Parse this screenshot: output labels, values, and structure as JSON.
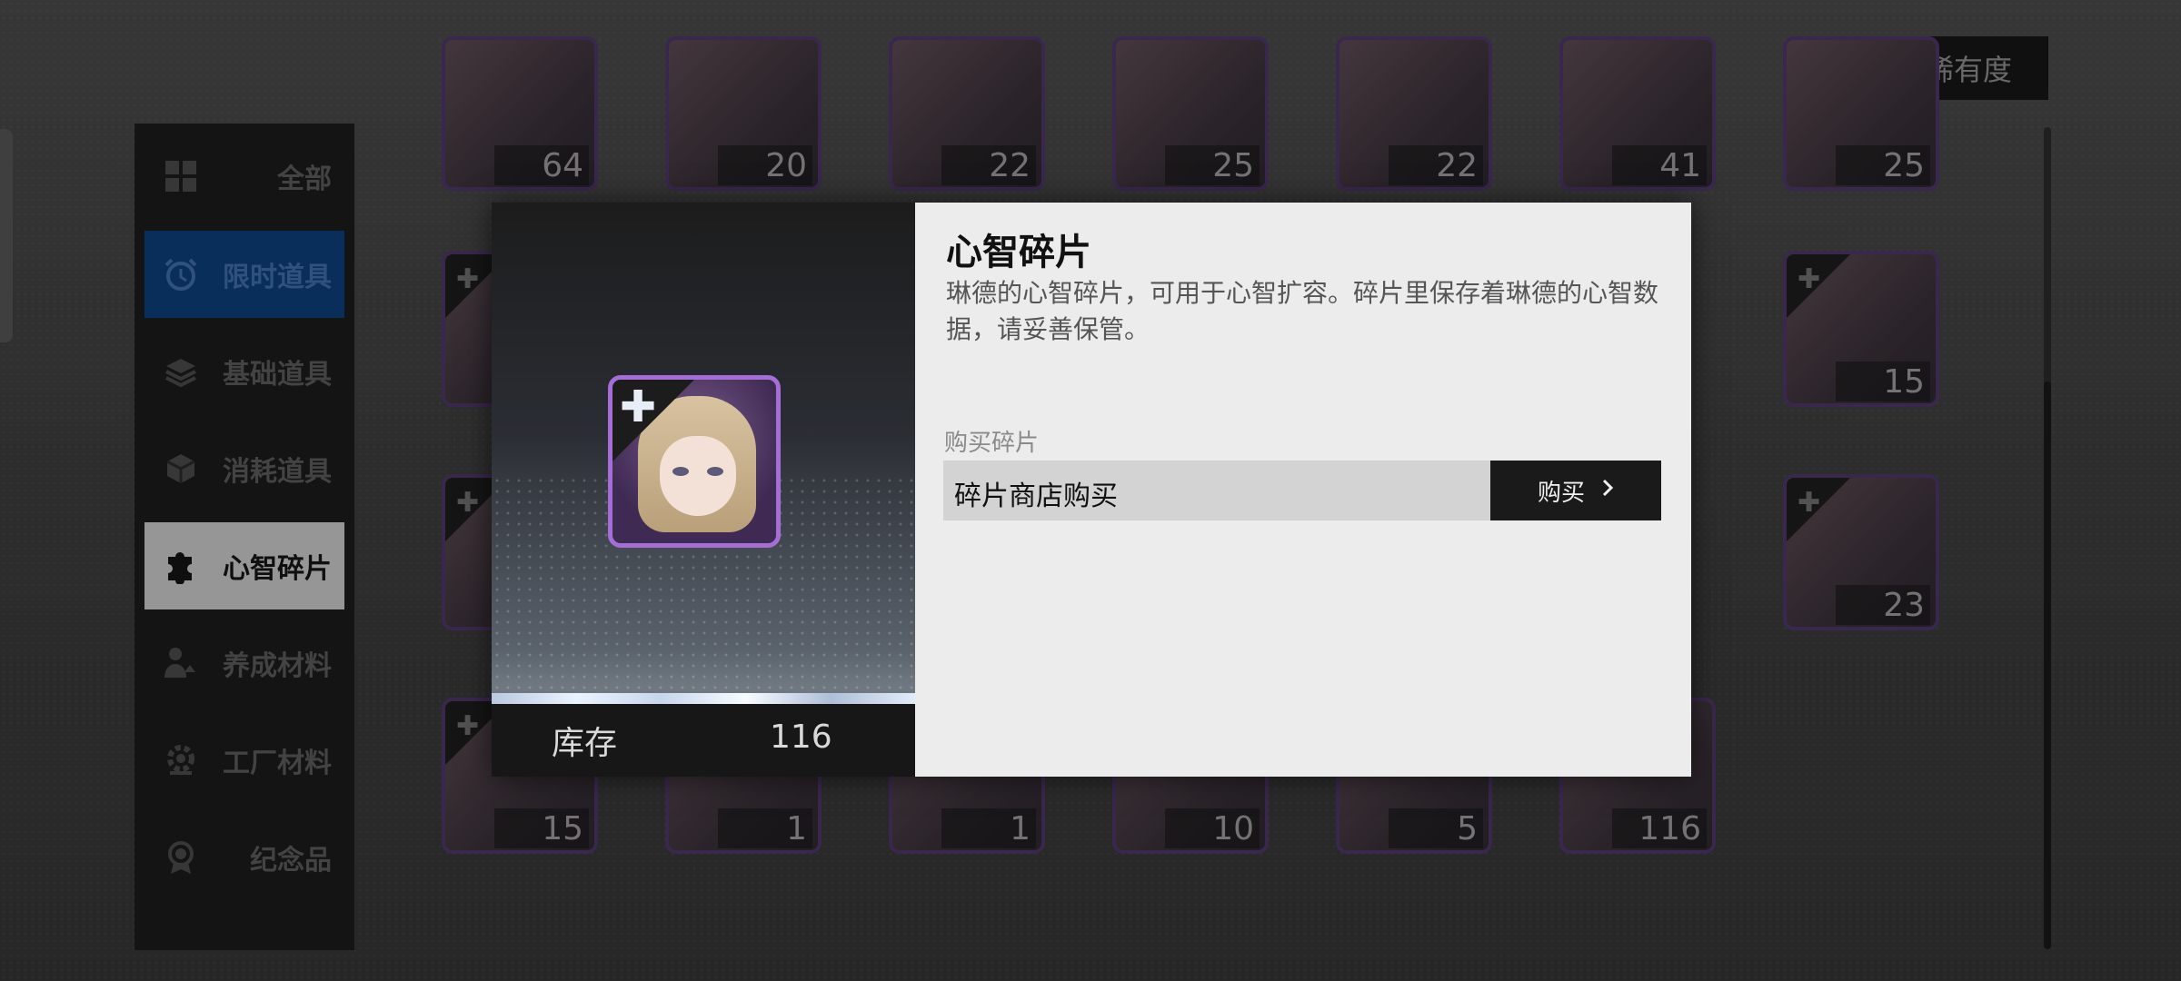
{
  "sort": {
    "label": "稀有度"
  },
  "sidebar": {
    "items": [
      {
        "label": "全部",
        "icon": "grid-icon"
      },
      {
        "label": "限时道具",
        "icon": "alarm-clock-icon"
      },
      {
        "label": "基础道具",
        "icon": "layers-icon"
      },
      {
        "label": "消耗道具",
        "icon": "cube-icon"
      },
      {
        "label": "心智碎片",
        "icon": "puzzle-piece-icon"
      },
      {
        "label": "养成材料",
        "icon": "person-upgrade-icon"
      },
      {
        "label": "工厂材料",
        "icon": "gear-hand-icon"
      },
      {
        "label": "纪念品",
        "icon": "medal-icon"
      }
    ],
    "active_index": 4
  },
  "grid": {
    "row1": [
      "64",
      "20",
      "22",
      "25",
      "22",
      "41",
      "25"
    ],
    "row2_right": "15",
    "row3_right": "23",
    "row4": [
      "15",
      "1",
      "1",
      "10",
      "5",
      "116"
    ]
  },
  "modal": {
    "title": "心智碎片",
    "description": "琳德的心智碎片，可用于心智扩容。碎片里保存着琳德的心智数据，请妥善保管。",
    "stock_label": "库存",
    "stock_value": "116",
    "buy_section_label": "购买碎片",
    "buy_source": "碎片商店购买",
    "buy_button": "购买"
  },
  "colors": {
    "accent_purple": "#a56ed6",
    "timed_blue": "#0d3e78",
    "active_bg": "#c9c9c9"
  }
}
